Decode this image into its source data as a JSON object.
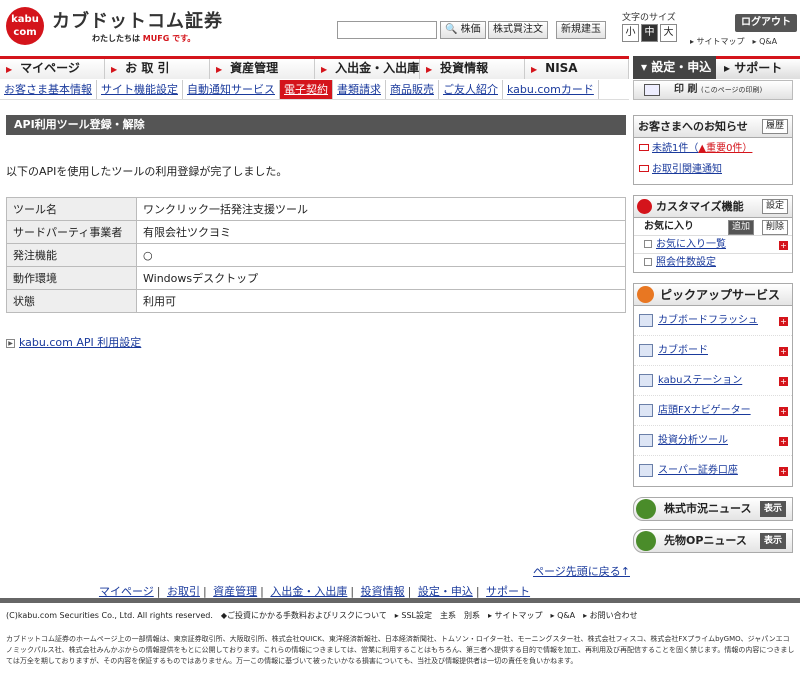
{
  "header": {
    "logo_badge": "kabu com",
    "logo_name": "カブドットコム証券",
    "logo_sub": "わたしたちは",
    "logo_sub_brand": "MUFG です。",
    "buttons": [
      "株価",
      "株式買注文",
      "新規建玉"
    ],
    "font_size_label": "文字のサイズ",
    "font_sizes": [
      "小",
      "中",
      "大"
    ],
    "logout": "ログアウト",
    "util_links": "▸ サイトマップ　▸ Q&A"
  },
  "nav": {
    "items": [
      "マイページ",
      "お 取 引",
      "資産管理",
      "入出金・入出庫",
      "投資情報",
      "NISA"
    ],
    "settings": "▾ 設定・申込",
    "support": "▸ サポート"
  },
  "subnav": {
    "items": [
      "お客さま基本情報",
      "サイト機能設定",
      "自動通知サービス",
      "電子契約",
      "書類請求",
      "商品販売",
      "ご友人紹介",
      "kabu.comカード"
    ],
    "active_index": 3,
    "print_label": "印 刷",
    "print_sub": "(このページの印刷)"
  },
  "main": {
    "title": "API利用ツール登録・解除",
    "message": "以下のAPIを使用したツールの利用登録が完了しました。",
    "table": [
      {
        "label": "ツール名",
        "value": "ワンクリック一括発注支援ツール"
      },
      {
        "label": "サードパーティ事業者",
        "value": "有限会社ツクヨミ"
      },
      {
        "label": "発注機能",
        "value": "○"
      },
      {
        "label": "動作環境",
        "value": "Windowsデスクトップ"
      },
      {
        "label": "状態",
        "value": "利用可"
      }
    ],
    "settings_link": "kabu.com API 利用設定"
  },
  "sidebar": {
    "notice_title": "お客さまへのお知らせ",
    "history_btn": "履歴",
    "unread": "未読1件（",
    "important": "▲重要0件）",
    "trade_notice": "お取引関連通知",
    "customize_title": "カスタマイズ機能",
    "customize_btn": "設定",
    "fav_label": "お気に入り",
    "fav_add": "追加",
    "fav_del": "削除",
    "fav_list": "お気に入り一覧",
    "query_setting": "照会件数設定",
    "pickup_title": "ピックアップサービス",
    "services": [
      "カブボードフラッシュ",
      "カブボード",
      "kabuステーション",
      "店頭FXナビゲーター",
      "投資分析ツール",
      "スーパー証券口座"
    ],
    "news": [
      "株式市況ニュース",
      "先物OPニュース"
    ],
    "show_btn": "表示"
  },
  "footer": {
    "page_top": "ページ先頭に戻る↑",
    "nav": [
      "マイページ",
      "お取引",
      "資産管理",
      "入出金・入出庫",
      "投資情報",
      "設定・申込",
      "サポート"
    ],
    "copyright": "(C)kabu.com Securities Co., Ltd. All rights reserved.　◆ご投資にかかる手数料およびリスクについて　▸ SSL設定　主系　別系　▸ サイトマップ　▸ Q&A　▸ お問い合わせ",
    "disclaimer": "カブドットコム証券のホームページ上の一部情報は、東京証券取引所、大阪取引所、株式会社QUICK、東洋経済新報社、日本経済新聞社、トムソン・ロイター社、モーニングスター社、株式会社フィスコ、株式会社FXプライムbyGMO、ジャパンエコノミックパルス社、株式会社みんかぶからの情報提供をもとに公開しております。これらの情報につきましては、営業に利用することはもちろん、第三者へ提供する目的で情報を加工、再利用及び再配信することを固く禁じます。情報の内容につきましては万全を期しておりますが、その内容を保証するものではありません。万一この情報に基づいて被ったいかなる損害についても、当社及び情報提供者は一切の責任を負いかねます。"
  }
}
